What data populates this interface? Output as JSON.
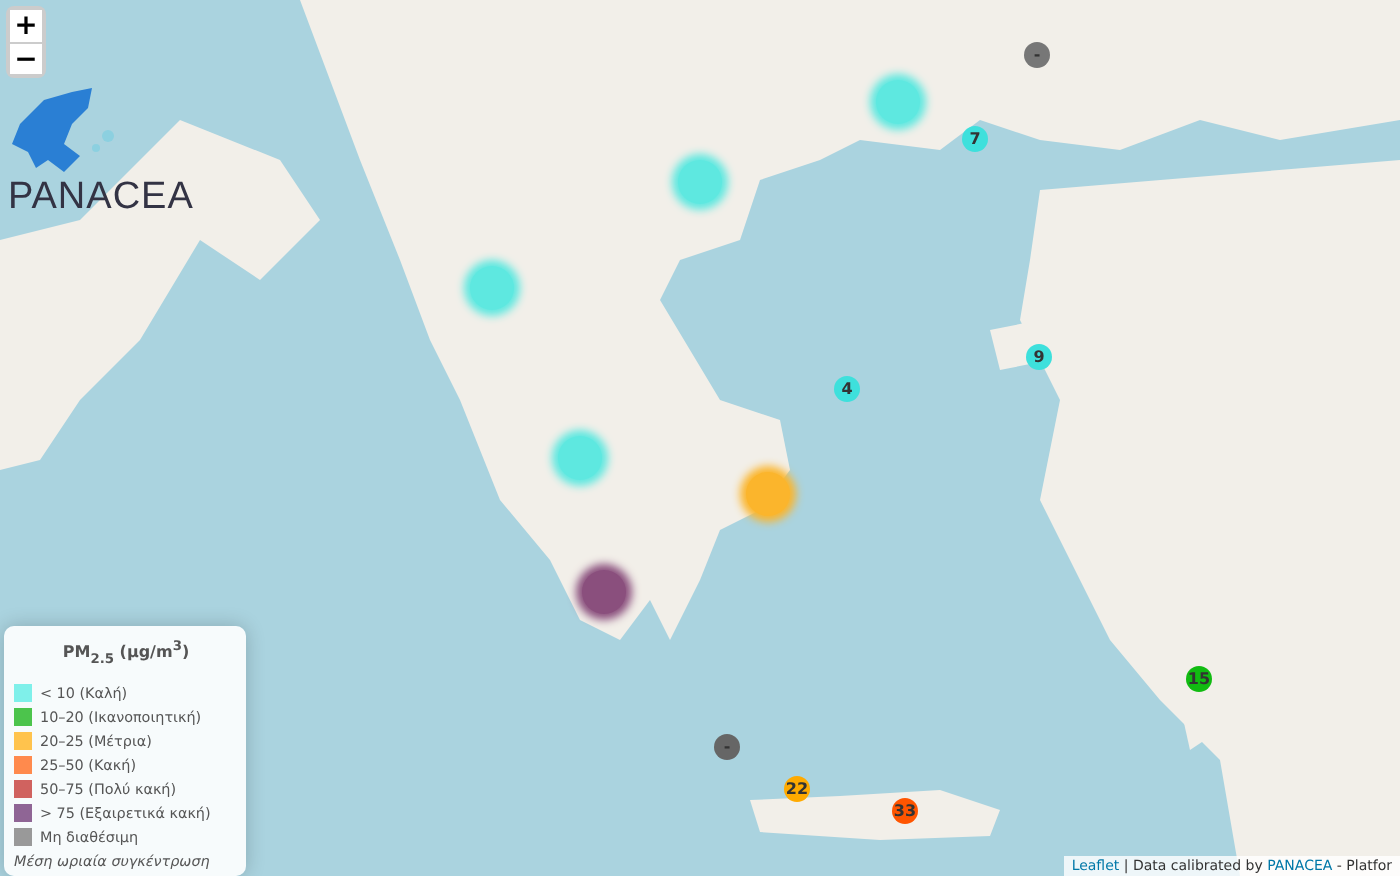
{
  "zoom_controls": [
    "+",
    "−"
  ],
  "logo": {
    "text": "PANACEA"
  },
  "markers": [
    {
      "kind": "station",
      "color": "#5ee8e0"
    },
    {
      "kind": "station",
      "color": "#5ee8e0"
    },
    {
      "kind": "station",
      "color": "#5ee8e0"
    },
    {
      "kind": "station",
      "color": "#5ee8e0"
    },
    {
      "kind": "station",
      "color": "#fbb52c"
    },
    {
      "kind": "station",
      "color": "#8a4f7d"
    },
    {
      "kind": "value",
      "color": "#777777",
      "value": "-"
    },
    {
      "kind": "value",
      "color": "#3ee0dc",
      "value": "7"
    },
    {
      "kind": "value",
      "color": "#3ee0dc",
      "value": "4"
    },
    {
      "kind": "value",
      "color": "#3ee0dc",
      "value": "9"
    },
    {
      "kind": "value",
      "color": "#666666",
      "value": "-"
    },
    {
      "kind": "value",
      "color": "#ffaa00",
      "value": "22"
    },
    {
      "kind": "value",
      "color": "#ff5500",
      "value": "33"
    },
    {
      "kind": "value",
      "color": "#11bb11",
      "value": "15"
    }
  ],
  "legend": {
    "title": "PM$_{2.5}$ (μg/m$^{3}$)",
    "items": [
      {
        "label": "< 10 (Καλή)",
        "color": "#7ff0ea"
      },
      {
        "label": "10–20 (Ικανοποιητική)",
        "color": "#4cc44c"
      },
      {
        "label": "20–25 (Μέτρια)",
        "color": "#ffc34d"
      },
      {
        "label": "25–50 (Κακή)",
        "color": "#ff8a4d"
      },
      {
        "label": "50–75 (Πολύ κακή)",
        "color": "#d0625f"
      },
      {
        "label": "> 75 (Εξαιρετικά κακή)",
        "color": "#8f6595"
      },
      {
        "label": "Μη διαθέσιμη",
        "color": "#999999"
      }
    ],
    "note": "Μέση ωριαία συγκέντρωση"
  },
  "attribution": {
    "library": "Leaflet",
    "separator": "|",
    "text": "Data calibrated by",
    "link": "PANACEA",
    "rest": "- Platfor"
  }
}
